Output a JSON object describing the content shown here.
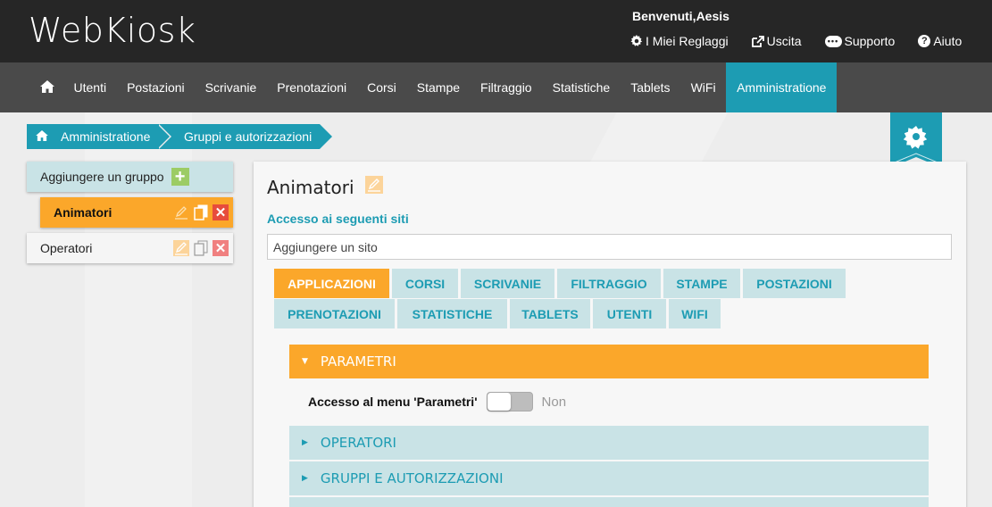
{
  "header": {
    "logo": "WebKiosk",
    "welcome": "Benvenuti,Aesis",
    "links": [
      {
        "label": "I Miei Reglaggi",
        "icon": "gear-icon"
      },
      {
        "label": "Uscita",
        "icon": "external-link-icon"
      },
      {
        "label": "Supporto",
        "icon": "chat-icon"
      },
      {
        "label": "Aiuto",
        "icon": "help-icon"
      }
    ]
  },
  "nav": {
    "home_icon": "home-icon",
    "items": [
      "Utenti",
      "Postazioni",
      "Scrivanie",
      "Prenotazioni",
      "Corsi",
      "Stampe",
      "Filtraggio",
      "Statistiche",
      "Tablets",
      "WiFi",
      "Amministratione"
    ],
    "active": "Amministratione"
  },
  "breadcrumb": {
    "items": [
      "Amministratione",
      "Gruppi e autorizzazioni"
    ]
  },
  "left": {
    "add_group": "Aggiungere un gruppo",
    "groups": [
      {
        "name": "Animatori",
        "selected": true
      },
      {
        "name": "Operatori",
        "selected": false
      }
    ]
  },
  "main": {
    "title": "Animatori",
    "access_label": "Accesso ai seguenti siti",
    "site_placeholder": "Aggiungere un sito",
    "tabs": [
      "APPLICAZIONI",
      "CORSI",
      "SCRIVANIE",
      "FILTRAGGIO",
      "STAMPE",
      "POSTAZIONI",
      "PRENOTAZIONI",
      "STATISTICHE",
      "TABLETS",
      "UTENTI",
      "WIFI"
    ],
    "active_tab": "APPLICAZIONI",
    "sections": {
      "parametri": "PARAMETRI",
      "operatori": "OPERATORI",
      "gruppi": "GRUPPI E AUTORIZZAZIONI"
    },
    "param_label": "Accesso al menu 'Parametri'",
    "toggle_state": "Non"
  },
  "colors": {
    "teal": "#1d9cb3",
    "orange": "#fba72a",
    "light_teal": "#c9e3e6",
    "dark": "#262626",
    "nav": "#4a4a4a"
  }
}
